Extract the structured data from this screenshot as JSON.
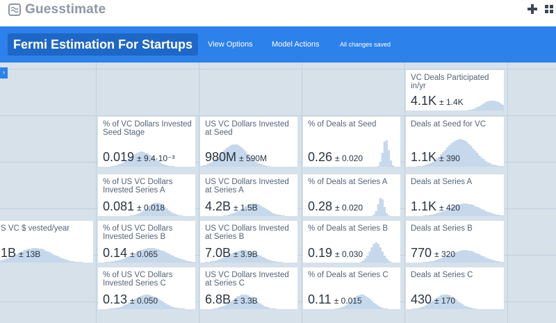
{
  "app": {
    "name": "Guesstimate"
  },
  "header": {
    "title": "Fermi Estimation For Startups",
    "view_options": "View Options",
    "model_actions": "Model Actions",
    "status": "All changes saved"
  },
  "colors": {
    "accent": "#2c81ea",
    "title_bg": "#1f67c6",
    "histogram": "#c6d8eb",
    "canvas": "#d6e1ea"
  },
  "icons": {
    "logo": "guesstimate-logo-icon",
    "add": "plus-icon",
    "apps": "grid-icon",
    "sidebar": "chevron-right-icon"
  },
  "cards": [
    {
      "id": "vc-deals-yr",
      "label": "VC Deals Participated in/yr",
      "value": "4.1K",
      "error": "± 1.4K"
    },
    {
      "id": "pct-dollars-seed",
      "label": "% of VC Dollars Invested Seed Stage",
      "value": "0.019",
      "error": "± 9.4·10⁻³"
    },
    {
      "id": "usd-seed",
      "label": "US VC Dollars Invested at Seed",
      "value": "980M",
      "error": "± 590M"
    },
    {
      "id": "pct-deals-seed",
      "label": "% of Deals at Seed",
      "value": "0.26",
      "error": "± 0.020"
    },
    {
      "id": "deals-seed",
      "label": "Deals at Seed for VC",
      "value": "1.1K",
      "error": "± 390"
    },
    {
      "id": "pct-dollars-a",
      "label": "% of US VC Dollars Invested Series A",
      "value": "0.081",
      "error": "± 0.018"
    },
    {
      "id": "usd-a",
      "label": "US VC Dollars Invested at Series A",
      "value": "4.2B",
      "error": "± 1.5B"
    },
    {
      "id": "pct-deals-a",
      "label": "% of Deals at Series A",
      "value": "0.28",
      "error": "± 0.020"
    },
    {
      "id": "deals-a",
      "label": "Deals at Series A",
      "value": "1.1K",
      "error": "± 420"
    },
    {
      "id": "us-vc-total",
      "label": "S VC $ vested/year",
      "value": "1B",
      "error": "± 13B"
    },
    {
      "id": "pct-dollars-b",
      "label": "% of US VC Dollars Invested Series B",
      "value": "0.14",
      "error": "± 0.065"
    },
    {
      "id": "usd-b",
      "label": "US VC Dollars Invested at Series B",
      "value": "7.0B",
      "error": "± 3.9B"
    },
    {
      "id": "pct-deals-b",
      "label": "% of Deals at Series B",
      "value": "0.19",
      "error": "± 0.030"
    },
    {
      "id": "deals-b",
      "label": "Deals at Series B",
      "value": "770",
      "error": "± 320"
    },
    {
      "id": "pct-dollars-c",
      "label": "% of US VC Dollars Invested Series C",
      "value": "0.13",
      "error": "± 0.050"
    },
    {
      "id": "usd-c",
      "label": "US VC Dollars Invested at Series C",
      "value": "6.8B",
      "error": "± 3.3B"
    },
    {
      "id": "pct-deals-c",
      "label": "% of Deals at Series C",
      "value": "0.11",
      "error": "± 0.015"
    },
    {
      "id": "deals-c",
      "label": "Deals at Series C",
      "value": "430",
      "error": "± 170"
    }
  ]
}
